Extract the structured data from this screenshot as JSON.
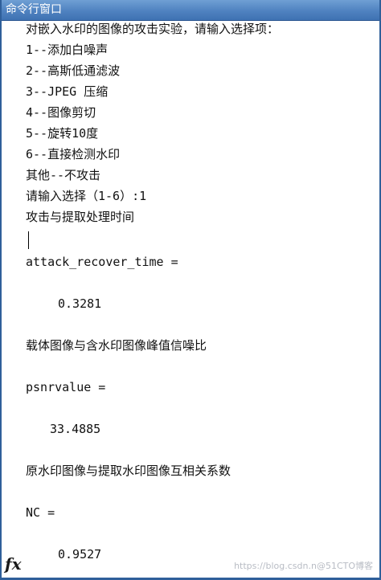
{
  "window": {
    "title": "命令行窗口"
  },
  "console": {
    "lines": [
      "对嵌入水印的图像的攻击实验，请输入选择项：",
      "1--添加白噪声",
      "2--高斯低通滤波",
      "3--JPEG 压缩",
      "4--图像剪切",
      "5--旋转10度",
      "6--直接检测水印",
      "其他--不攻击",
      "请输入选择（1-6）:1",
      "攻击与提取处理时间",
      "attack_recover_time =",
      "0.3281",
      "载体图像与含水印图像峰值信噪比",
      "psnrvalue =",
      "33.4885",
      "原水印图像与提取水印图像互相关系数",
      "NC =",
      "0.9527"
    ]
  },
  "prompt": {
    "icon": "fx-icon",
    "label": "fx"
  },
  "watermark": "https://blog.csdn.n@51CTO博客",
  "colors": {
    "titlebar": "#4f82c0",
    "border": "#2f5f9a",
    "text": "#111111"
  }
}
